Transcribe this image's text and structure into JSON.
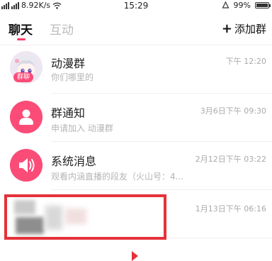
{
  "status_bar": {
    "network": "8.92K/s",
    "time": "15:29",
    "battery": "99%",
    "battery_level": 0.99
  },
  "header": {
    "tabs": [
      {
        "label": "聊天",
        "active": true
      },
      {
        "label": "互动",
        "active": false
      }
    ],
    "add_group_label": "添加群"
  },
  "chats": [
    {
      "title": "动漫群",
      "subtitle": "你们哪里的",
      "time": "下午 12:20",
      "badge": "群聊",
      "avatar": "anime-girl-avatar"
    },
    {
      "title": "群通知",
      "subtitle": "申请加入 动漫群",
      "time": "3月6日下午 09:30",
      "avatar": "person-icon"
    },
    {
      "title": "系统消息",
      "subtitle": "观看内涵直播的段友（火山号：4...",
      "time": "2月12日下午 03:22",
      "avatar": "speaker-icon"
    },
    {
      "title": "",
      "subtitle": "",
      "time": "1月13日下午 06:16",
      "avatar": "blurred"
    }
  ],
  "colors": {
    "accent": "#fb4c78",
    "highlight_box": "#e5323a"
  }
}
